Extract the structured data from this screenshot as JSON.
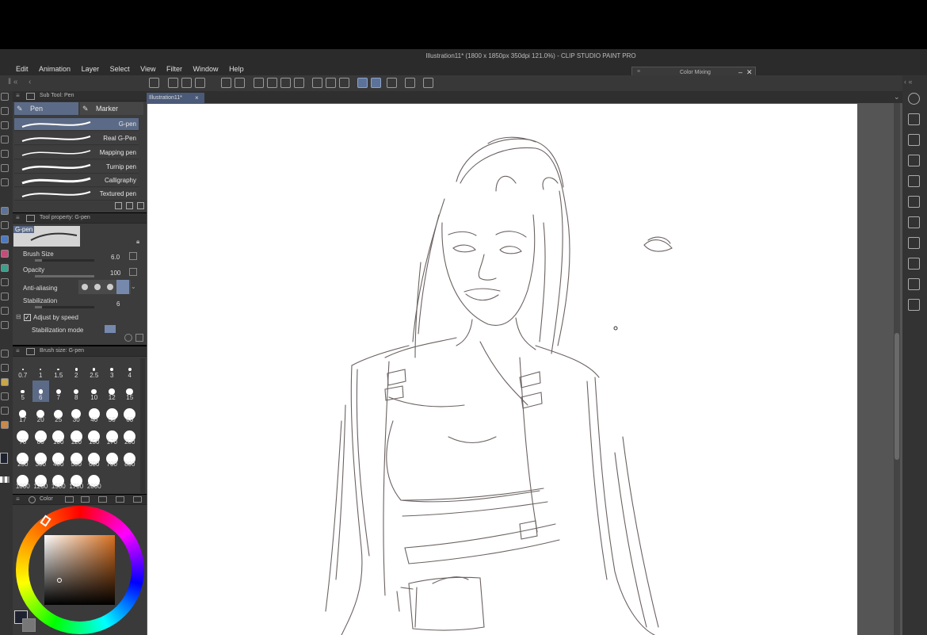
{
  "window": {
    "title": "Illustration11* (1800 x 1850px 350dpi 121.0%)  - CLIP STUDIO PAINT PRO"
  },
  "menu": [
    "Edit",
    "Animation",
    "Layer",
    "Select",
    "View",
    "Filter",
    "Window",
    "Help"
  ],
  "color_mixing_panel": {
    "title": "Color Mixing"
  },
  "document": {
    "tab_label": "Illustration11*"
  },
  "sub_tool_panel": {
    "header": "Sub Tool: Pen",
    "tabs": [
      "Pen",
      "Marker"
    ],
    "brushes": [
      "G-pen",
      "Real G-Pen",
      "Mapping pen",
      "Turnip pen",
      "Calligraphy",
      "Textured pen"
    ],
    "selected": "G-pen"
  },
  "tool_property_panel": {
    "header": "Tool property: G-pen",
    "preview_label": "G-pen",
    "brush_size_label": "Brush Size",
    "brush_size_value": "6.0",
    "brush_size_fraction": 0.12,
    "opacity_label": "Opacity",
    "opacity_value": "100",
    "opacity_fraction": 1.0,
    "anti_aliasing_label": "Anti-aliasing",
    "stabilization_label": "Stabilization",
    "stabilization_value": "6",
    "stabilization_fraction": 0.12,
    "adjust_by_speed_label": "Adjust by speed",
    "stabilization_mode_label": "Stabilization mode"
  },
  "brush_size_panel": {
    "header": "Brush size: G-pen",
    "sizes": [
      "0.7",
      "1",
      "1.5",
      "2",
      "2.5",
      "3",
      "4",
      "5",
      "6",
      "7",
      "8",
      "10",
      "12",
      "15",
      "17",
      "20",
      "25",
      "30",
      "40",
      "50",
      "60",
      "70",
      "80",
      "100",
      "120",
      "150",
      "170",
      "200",
      "250",
      "300",
      "400",
      "500",
      "600",
      "700",
      "800",
      "1000",
      "1200",
      "1500",
      "1700",
      "2000"
    ],
    "selected": "6"
  },
  "color_panel": {
    "header": "Color",
    "main_color": "#d9701f",
    "wheel_hue_color": "#e87a1a"
  }
}
